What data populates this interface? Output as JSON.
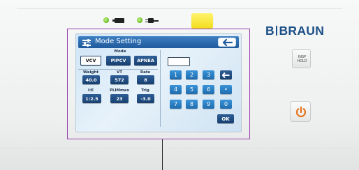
{
  "screen": {
    "title": "Mode Setting",
    "mode_label": "Mode",
    "modes": [
      "VCV",
      "PIPCV",
      "APNEA"
    ],
    "selected_mode": "VCV",
    "params_row1": [
      {
        "label": "Weight",
        "value": "40.0"
      },
      {
        "label": "VT",
        "value": "572"
      },
      {
        "label": "Rate",
        "value": "8"
      }
    ],
    "params_row2": [
      {
        "label": "I:E",
        "value": "1:2.5"
      },
      {
        "label": "PLIMmax",
        "value": "23"
      },
      {
        "label": "Trig",
        "value": "-3.0"
      }
    ],
    "input_value": "",
    "keypad": {
      "row1": [
        "1",
        "2",
        "3"
      ],
      "row2": [
        "4",
        "5",
        "6"
      ],
      "row3": [
        "7",
        "8",
        "9",
        "0"
      ],
      "dot": "•",
      "ok": "OK"
    }
  },
  "device": {
    "brand_left": "B",
    "brand_right": "BRAUN",
    "insp_hold_line1": "INSP",
    "insp_hold_line2": "HOLD",
    "accent_color": "#1b4f86",
    "screen_header_color": "#2f6eb0",
    "key_color": "#2a81c8",
    "indicator_color": "#6fc12a",
    "yellow_key_color": "#f6e52f",
    "power_color": "#e8731d"
  },
  "icons": [
    "battery-icon",
    "plug-icon",
    "settings-icon",
    "back-arrow-icon",
    "backspace-arrow-icon",
    "power-icon"
  ]
}
